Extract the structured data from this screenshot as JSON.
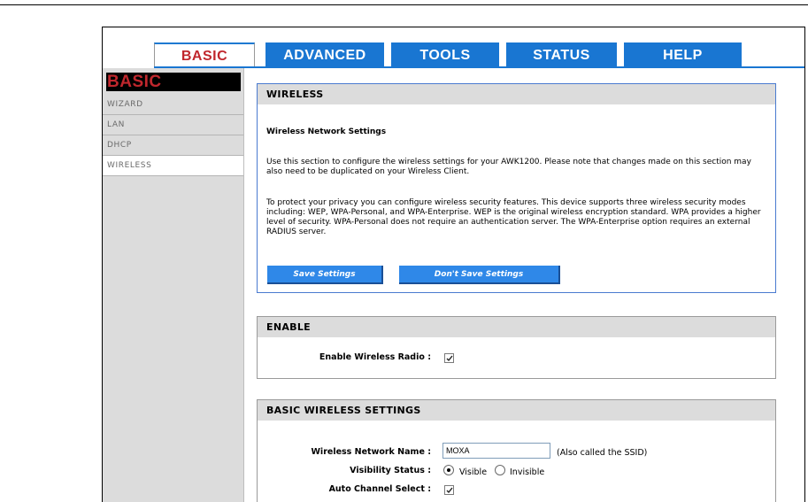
{
  "tabs": [
    {
      "label": "BASIC",
      "active": true
    },
    {
      "label": "ADVANCED",
      "active": false
    },
    {
      "label": "TOOLS",
      "active": false
    },
    {
      "label": "STATUS",
      "active": false
    },
    {
      "label": "HELP",
      "active": false
    }
  ],
  "sidebar": {
    "title": "BASIC",
    "items": [
      {
        "label": "WIZARD",
        "active": false
      },
      {
        "label": "LAN",
        "active": false
      },
      {
        "label": "DHCP",
        "active": false
      },
      {
        "label": "WIRELESS",
        "active": true
      }
    ]
  },
  "wireless_panel": {
    "title": "WIRELESS",
    "subtitle": "Wireless Network Settings",
    "para1": "Use this section to configure the wireless settings for your AWK1200. Please note that changes made on this section may also need to be duplicated on your Wireless Client.",
    "para2": "To protect your privacy you can configure wireless security features. This device supports three wireless security modes including: WEP, WPA-Personal, and WPA-Enterprise. WEP is the original wireless encryption standard. WPA provides a higher level of security. WPA-Personal does not require an authentication server. The WPA-Enterprise option requires an external RADIUS server.",
    "save_label": "Save Settings",
    "dont_save_label": "Don't Save Settings"
  },
  "enable_panel": {
    "title": "ENABLE",
    "radio_label": "Enable Wireless Radio :",
    "radio_checked": true
  },
  "basic_panel": {
    "title": "BASIC WIRELESS SETTINGS",
    "ssid_label": "Wireless Network Name :",
    "ssid_value": "MOXA",
    "ssid_hint": "(Also called the SSID)",
    "visibility_label": "Visibility Status :",
    "visible_label": "Visible",
    "invisible_label": "Invisible",
    "visibility_selected": "Visible",
    "auto_channel_label": "Auto Channel Select :",
    "auto_channel_checked": true
  },
  "colors": {
    "tab_blue": "#1976d2",
    "brand_red": "#c0272d",
    "button_blue": "#2f88e8",
    "panel_border": "#4a7bd0"
  }
}
